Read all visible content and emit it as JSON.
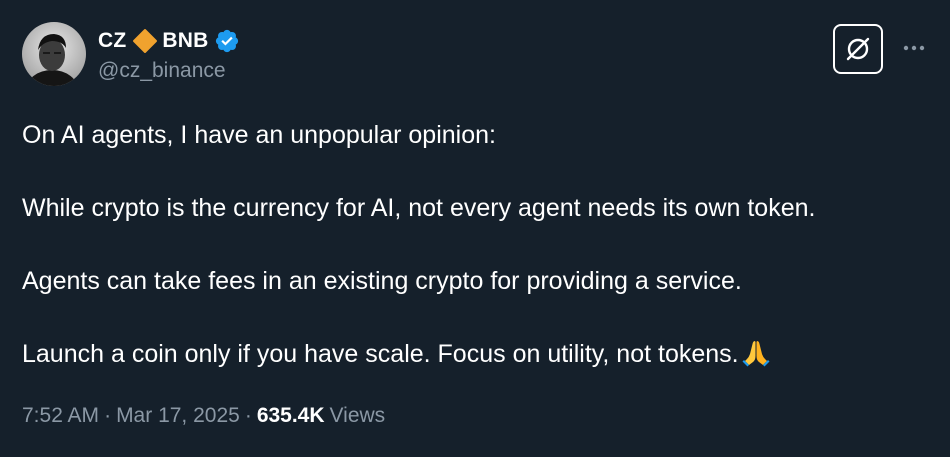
{
  "author": {
    "name": "CZ",
    "name_suffix": "BNB",
    "handle": "@cz_binance",
    "avatar_icon": "profile-photo",
    "badge_icon": "bnb-diamond-icon",
    "verified_icon": "verified-badge-icon"
  },
  "actions": {
    "grok_icon": "grok-icon",
    "more_icon": "more-dots-icon"
  },
  "tweet": {
    "paragraphs": [
      "On AI agents, I have an unpopular opinion:",
      "While crypto is the currency for AI, not every agent needs its own token.",
      "Agents can take fees in an existing crypto for providing a service.",
      "Launch a coin only if you have scale. Focus on utility, not tokens."
    ],
    "trailing_emoji_icon": "folded-hands-emoji"
  },
  "meta": {
    "time": "7:52 AM",
    "separator": "·",
    "date": "Mar 17, 2025",
    "views_count": "635.4K",
    "views_label": "Views"
  },
  "colors": {
    "background": "#15202b",
    "text": "#ffffff",
    "secondary_text": "#8b98a5",
    "verified_blue": "#1d9bf0",
    "bnb_orange": "#f0a22e"
  }
}
